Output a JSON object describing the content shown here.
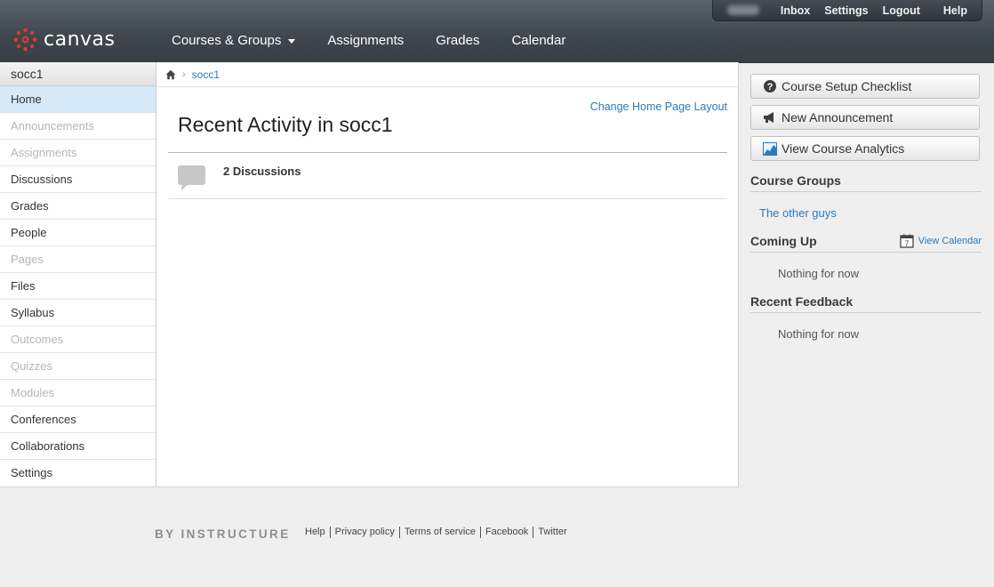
{
  "header": {
    "brand": "canvas",
    "user_nav": [
      "Inbox",
      "Settings",
      "Logout",
      "Help"
    ],
    "main_nav": [
      "Courses & Groups",
      "Assignments",
      "Grades",
      "Calendar"
    ]
  },
  "left_nav": {
    "course": "socc1",
    "items": [
      {
        "label": "Home"
      },
      {
        "label": "Announcements"
      },
      {
        "label": "Assignments"
      },
      {
        "label": "Discussions"
      },
      {
        "label": "Grades"
      },
      {
        "label": "People"
      },
      {
        "label": "Pages"
      },
      {
        "label": "Files"
      },
      {
        "label": "Syllabus"
      },
      {
        "label": "Outcomes"
      },
      {
        "label": "Quizzes"
      },
      {
        "label": "Modules"
      },
      {
        "label": "Conferences"
      },
      {
        "label": "Collaborations"
      },
      {
        "label": "Settings"
      }
    ]
  },
  "breadcrumb": {
    "course": "socc1"
  },
  "content": {
    "change_layout": "Change Home Page Layout",
    "title": "Recent Activity in socc1",
    "activity": "2 Discussions"
  },
  "sidebar": {
    "buttons": [
      "Course Setup Checklist",
      "New Announcement",
      "View Course Analytics"
    ],
    "course_groups_heading": "Course Groups",
    "group_link": "The other guys",
    "coming_up_heading": "Coming Up",
    "view_calendar": "View Calendar",
    "calendar_day": "7",
    "coming_up_empty": "Nothing for now",
    "recent_feedback_heading": "Recent Feedback",
    "feedback_empty": "Nothing for now"
  },
  "footer": {
    "brand": "BY INSTRUCTURE",
    "links": [
      "Help",
      "Privacy policy",
      "Terms of service",
      "Facebook",
      "Twitter"
    ]
  },
  "colors": {
    "header_bg": "#474e55",
    "link": "#2a7abc",
    "active_nav": "#d6e9f8",
    "logo_red": "#e23c2b",
    "page_bg": "#efefef"
  }
}
